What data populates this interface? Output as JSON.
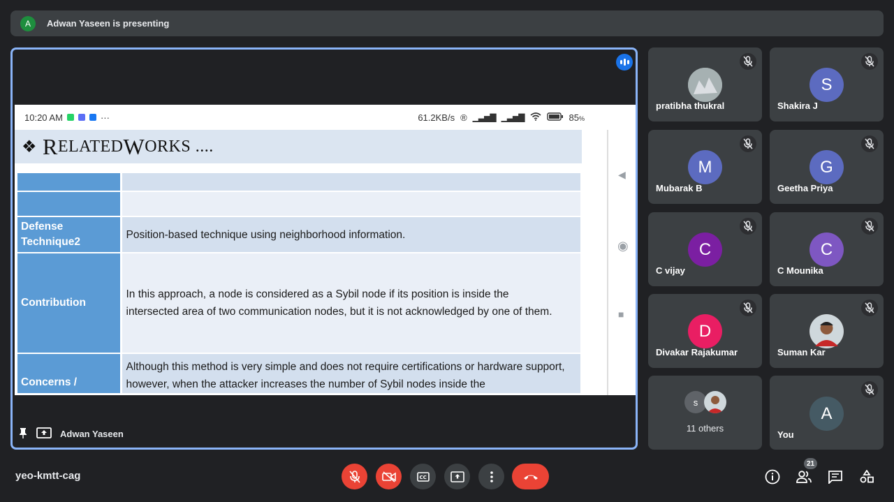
{
  "presenting": {
    "avatar_letter": "A",
    "text": "Adwan Yaseen is presenting"
  },
  "phone_status": {
    "time": "10:20 AM",
    "overflow": "···",
    "speed": "61.2KB/s",
    "battery": "85",
    "battery_unit": "%"
  },
  "slide": {
    "title_prefix": "R",
    "title_rest": "ELATED ",
    "title_w": "W",
    "title_works": "ORKS ....",
    "rows": [
      {
        "label": "",
        "value": ""
      },
      {
        "label": "",
        "value": ""
      },
      {
        "label": "Defense Technique2",
        "value": "Position-based technique using neighborhood information."
      },
      {
        "label": "Contribution",
        "value": "In this approach, a node is considered as a Sybil node if its position is inside the intersected area of two communication nodes, but it is not acknowledged by one of them."
      },
      {
        "label": "Concerns /",
        "value": "Although this method is very simple and does not require certifications or hardware support, however, when the attacker increases the number of Sybil nodes inside the"
      }
    ]
  },
  "presenter_name": "Adwan Yaseen",
  "participants": [
    {
      "name": "pratibha thukral",
      "initial": "",
      "color": "#7b8a8b",
      "muted": true
    },
    {
      "name": "Shakira J",
      "initial": "S",
      "color": "#5c6bc0",
      "muted": true
    },
    {
      "name": "Mubarak B",
      "initial": "M",
      "color": "#5c6bc0",
      "muted": true
    },
    {
      "name": "Geetha Priya",
      "initial": "G",
      "color": "#5c6bc0",
      "muted": true
    },
    {
      "name": "C vijay",
      "initial": "C",
      "color": "#7b1fa2",
      "muted": true
    },
    {
      "name": "C Mounika",
      "initial": "C",
      "color": "#7e57c2",
      "muted": true
    },
    {
      "name": "Divakar Rajakumar",
      "initial": "D",
      "color": "#e91e63",
      "muted": true
    },
    {
      "name": "Suman Kar",
      "initial": "",
      "color": "#6d4c41",
      "muted": true
    },
    {
      "name": "11 others",
      "initial": "s",
      "color": "#5f6368",
      "muted": false
    },
    {
      "name": "You",
      "initial": "A",
      "color": "#455a64",
      "muted": true
    }
  ],
  "meeting_code": "yeo-kmtt-cag",
  "people_count": "21",
  "colors": {
    "accent": "#8ab4f8",
    "danger": "#ea4335",
    "tile": "#3c4043",
    "background": "#202124"
  }
}
